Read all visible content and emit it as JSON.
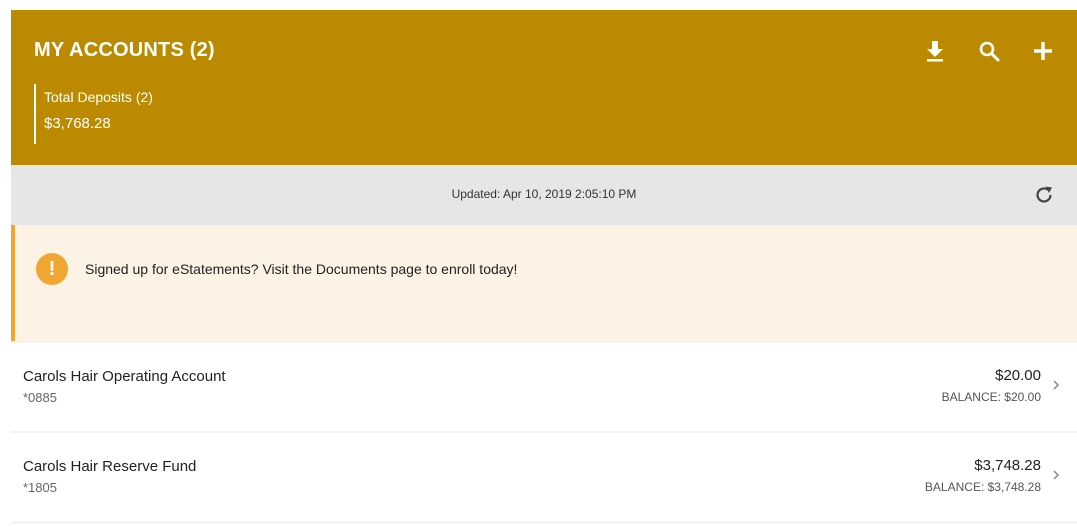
{
  "header": {
    "title": "MY ACCOUNTS (2)",
    "totals_label": "Total Deposits (2)",
    "totals_amount": "$3,768.28",
    "icons": [
      "download-icon",
      "search-icon",
      "plus-icon"
    ]
  },
  "status": {
    "updated_text": "Updated: Apr 10, 2019 2:05:10 PM",
    "refresh_icon": "refresh-icon"
  },
  "alert": {
    "icon_glyph": "!",
    "message": "Signed up for eStatements?  Visit the Documents page to enroll today!"
  },
  "accounts": [
    {
      "name": "Carols Hair Operating Account",
      "number": "*0885",
      "amount": "$20.00",
      "balance": "BALANCE: $20.00"
    },
    {
      "name": "Carols Hair Reserve Fund",
      "number": "*1805",
      "amount": "$3,748.28",
      "balance": "BALANCE: $3,748.28"
    }
  ],
  "colors": {
    "header": "#bc8a00",
    "alert_accent": "#f0a732",
    "alert_bg": "#fcf3e5",
    "status_bar": "#e6e6e6"
  }
}
